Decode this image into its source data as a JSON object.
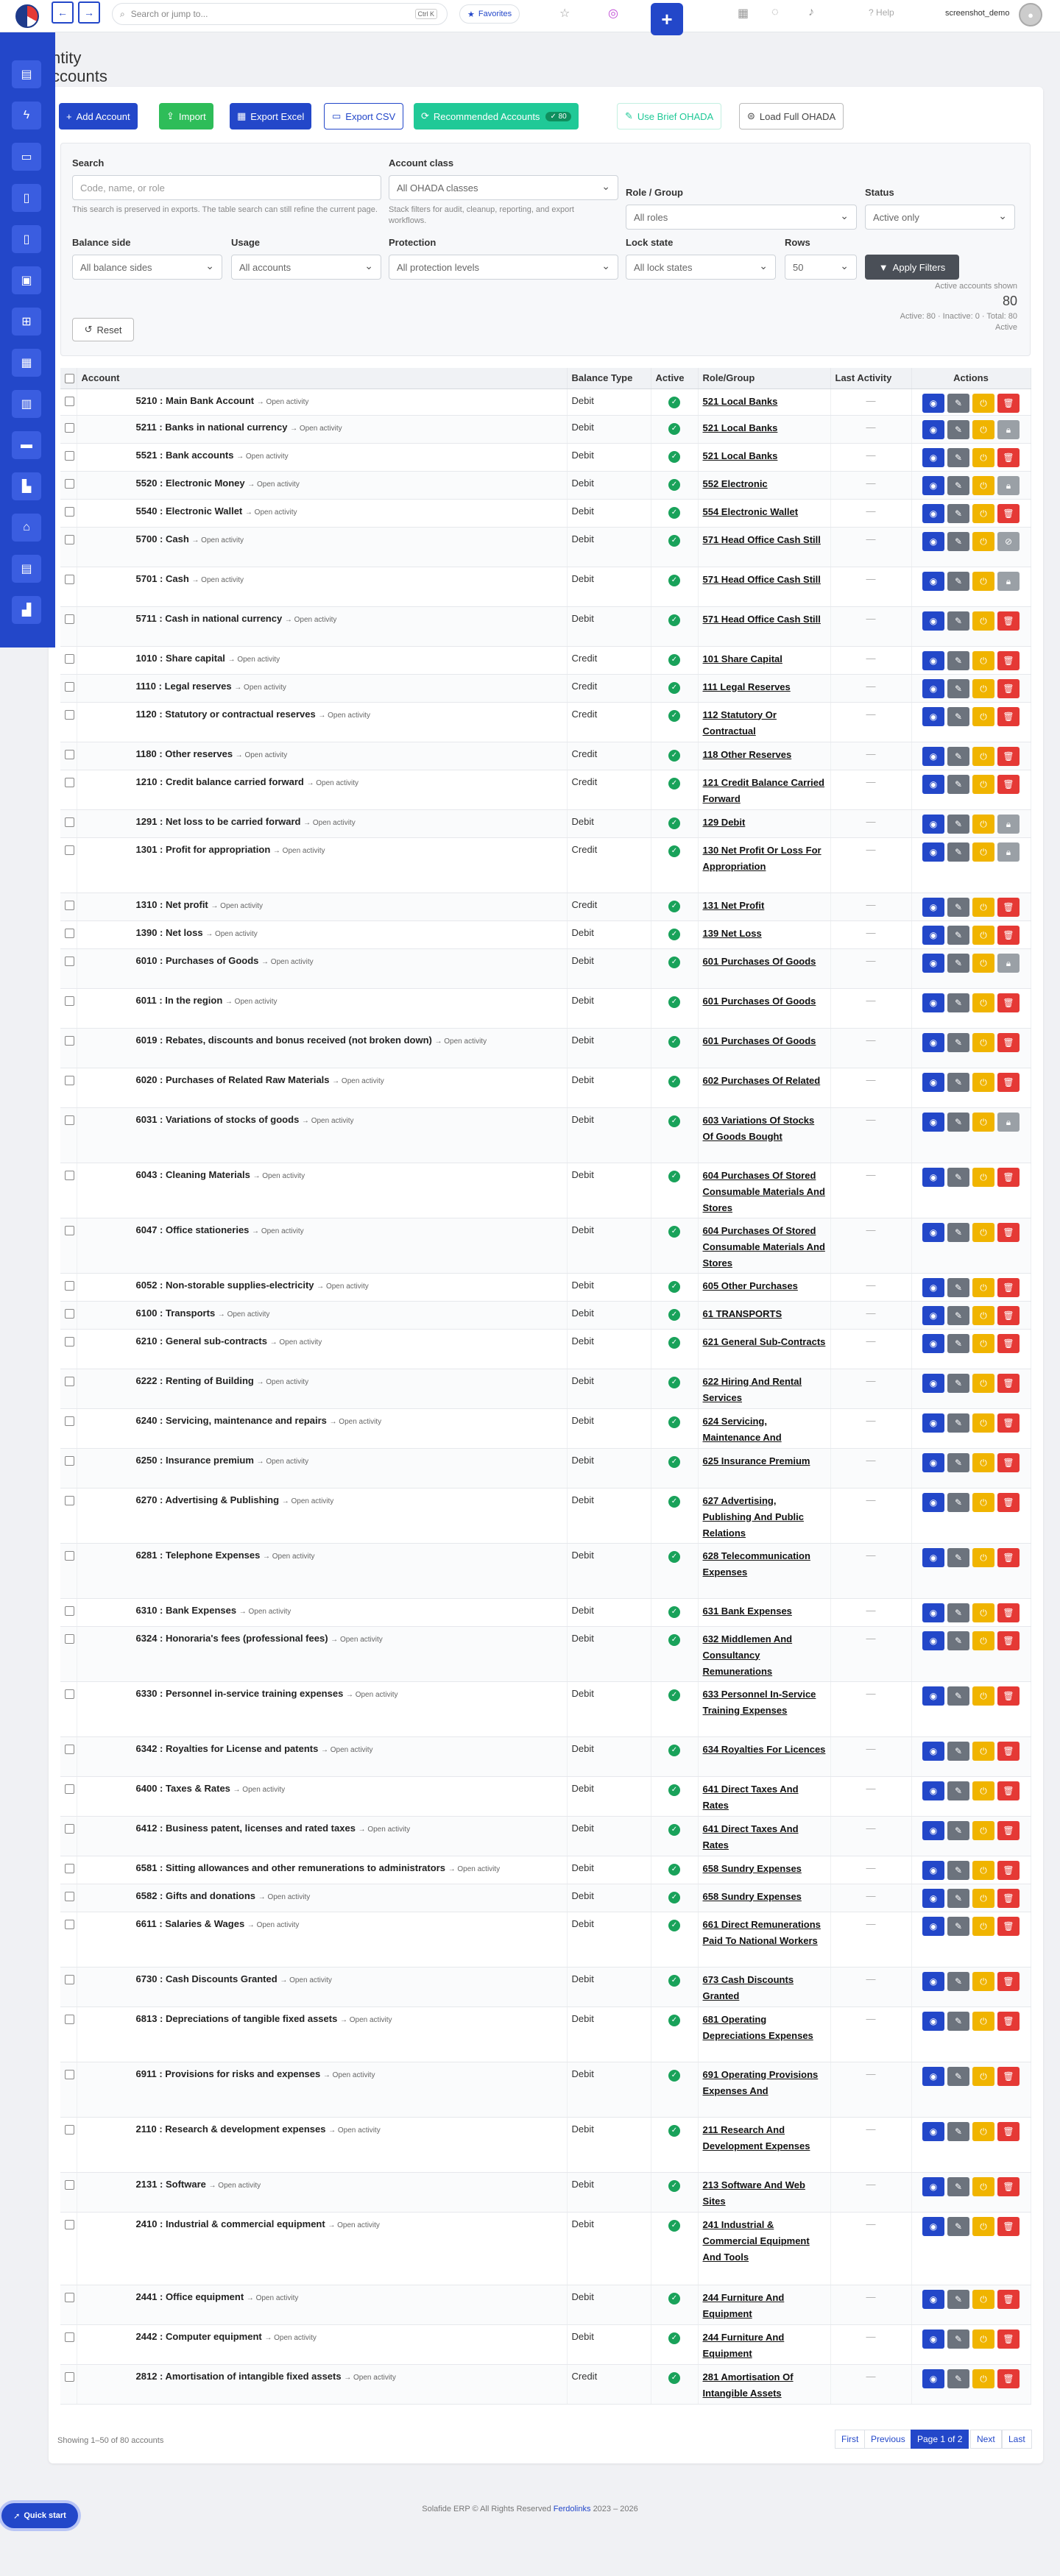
{
  "topbar": {
    "search_placeholder": "Search or jump to...",
    "search_kbd": "Ctrl K",
    "favorites": "Favorites",
    "help": "Help",
    "user": "screenshot_demo"
  },
  "page": {
    "title_line1": "ntity",
    "title_line2": "ccounts"
  },
  "toolbar": {
    "add": "Add Account",
    "import": "Import",
    "export_excel": "Export Excel",
    "export_csv": "Export CSV",
    "recommended": "Recommended Accounts",
    "recommended_count": "80",
    "brief_ohada": "Use Brief OHADA",
    "full_ohada": "Load Full OHADA"
  },
  "filters": {
    "search_label": "Search",
    "search_placeholder": "Code, name, or role",
    "search_hint": "This search is preserved in exports. The table search can still refine the current page.",
    "class_label": "Account class",
    "class_value": "All OHADA classes",
    "class_hint": "Stack filters for audit, cleanup, reporting, and export workflows.",
    "role_label": "Role / Group",
    "role_value": "All roles",
    "status_label": "Status",
    "status_value": "Active only",
    "balance_label": "Balance side",
    "balance_value": "All balance sides",
    "usage_label": "Usage",
    "usage_value": "All accounts",
    "protection_label": "Protection",
    "protection_value": "All protection levels",
    "lock_label": "Lock state",
    "lock_value": "All lock states",
    "rows_label": "Rows",
    "rows_value": "50",
    "apply": "Apply Filters",
    "reset": "Reset",
    "stats_label": "Active accounts shown",
    "stats_count": "80",
    "stats_detail": "Active: 80 · Inactive: 0 · Total: 80",
    "stats_active": "Active"
  },
  "table": {
    "headers": [
      "Account",
      "Balance Type",
      "Active",
      "Role/Group",
      "Last Activity",
      "Actions"
    ],
    "open_activity": "→ Open activity",
    "last_activity_empty": "—",
    "rows": [
      {
        "code": "5210",
        "name": "Main Bank Account",
        "balance": "Debit",
        "role": "521 Local Banks",
        "actions": "del"
      },
      {
        "code": "5211",
        "name": "Banks in national currency",
        "balance": "Debit",
        "role": "521 Local Banks",
        "actions": "lock"
      },
      {
        "code": "5521",
        "name": "Bank accounts",
        "balance": "Debit",
        "role": "521 Local Banks",
        "actions": "del"
      },
      {
        "code": "5520",
        "name": "Electronic Money",
        "balance": "Debit",
        "role": "552 Electronic",
        "actions": "lock"
      },
      {
        "code": "5540",
        "name": "Electronic Wallet",
        "balance": "Debit",
        "role": "554 Electronic Wallet",
        "actions": "del"
      },
      {
        "code": "5700",
        "name": "Cash",
        "balance": "Debit",
        "role": "571 Head Office Cash Still",
        "actions": "ban"
      },
      {
        "code": "5701",
        "name": "Cash",
        "balance": "Debit",
        "role": "571 Head Office Cash Still",
        "actions": "lock"
      },
      {
        "code": "5711",
        "name": "Cash in national currency",
        "balance": "Debit",
        "role": "571 Head Office Cash Still",
        "actions": "del"
      },
      {
        "code": "1010",
        "name": "Share capital",
        "balance": "Credit",
        "role": "101 Share Capital",
        "actions": "del"
      },
      {
        "code": "1110",
        "name": "Legal reserves",
        "balance": "Credit",
        "role": "111 Legal Reserves",
        "actions": "del"
      },
      {
        "code": "1120",
        "name": "Statutory or contractual reserves",
        "balance": "Credit",
        "role": "112 Statutory Or Contractual",
        "actions": "del"
      },
      {
        "code": "1180",
        "name": "Other reserves",
        "balance": "Credit",
        "role": "118 Other Reserves",
        "actions": "del"
      },
      {
        "code": "1210",
        "name": "Credit balance carried forward",
        "balance": "Credit",
        "role": "121 Credit Balance Carried Forward",
        "actions": "del"
      },
      {
        "code": "1291",
        "name": "Net loss to be carried forward",
        "balance": "Debit",
        "role": "129 Debit",
        "actions": "lock"
      },
      {
        "code": "1301",
        "name": "Profit for appropriation",
        "balance": "Credit",
        "role": "130 Net Profit Or Loss For Appropriation",
        "actions": "lock"
      },
      {
        "code": "1310",
        "name": "Net profit",
        "balance": "Credit",
        "role": "131 Net Profit",
        "actions": "del"
      },
      {
        "code": "1390",
        "name": "Net loss",
        "balance": "Debit",
        "role": "139 Net Loss",
        "actions": "del"
      },
      {
        "code": "6010",
        "name": "Purchases of Goods",
        "balance": "Debit",
        "role": "601 Purchases Of Goods",
        "actions": "lock"
      },
      {
        "code": "6011",
        "name": "In the region",
        "balance": "Debit",
        "role": "601 Purchases Of Goods",
        "actions": "del"
      },
      {
        "code": "6019",
        "name": "Rebates, discounts and bonus received (not broken down)",
        "balance": "Debit",
        "role": "601 Purchases Of Goods",
        "actions": "del"
      },
      {
        "code": "6020",
        "name": "Purchases of Related Raw Materials",
        "balance": "Debit",
        "role": "602 Purchases Of Related",
        "actions": "del"
      },
      {
        "code": "6031",
        "name": "Variations of stocks of goods",
        "balance": "Debit",
        "role": "603 Variations Of Stocks Of Goods Bought",
        "actions": "lock"
      },
      {
        "code": "6043",
        "name": "Cleaning Materials",
        "balance": "Debit",
        "role": "604 Purchases Of Stored Consumable Materials And Stores",
        "actions": "del"
      },
      {
        "code": "6047",
        "name": "Office stationeries",
        "balance": "Debit",
        "role": "604 Purchases Of Stored Consumable Materials And Stores",
        "actions": "del"
      },
      {
        "code": "6052",
        "name": "Non-storable supplies-electricity",
        "balance": "Debit",
        "role": "605 Other Purchases",
        "actions": "del"
      },
      {
        "code": "6100",
        "name": "Transports",
        "balance": "Debit",
        "role": "61 TRANSPORTS",
        "actions": "del"
      },
      {
        "code": "6210",
        "name": "General sub-contracts",
        "balance": "Debit",
        "role": "621 General Sub-Contracts",
        "actions": "del"
      },
      {
        "code": "6222",
        "name": "Renting of Building",
        "balance": "Debit",
        "role": "622 Hiring And Rental Services",
        "actions": "del"
      },
      {
        "code": "6240",
        "name": "Servicing, maintenance and repairs",
        "balance": "Debit",
        "role": "624 Servicing, Maintenance And",
        "actions": "del"
      },
      {
        "code": "6250",
        "name": "Insurance premium",
        "balance": "Debit",
        "role": "625 Insurance Premium",
        "actions": "del"
      },
      {
        "code": "6270",
        "name": "Advertising & Publishing",
        "balance": "Debit",
        "role": "627 Advertising, Publishing And Public Relations",
        "actions": "del"
      },
      {
        "code": "6281",
        "name": "Telephone Expenses",
        "balance": "Debit",
        "role": "628 Telecommunication Expenses",
        "actions": "del"
      },
      {
        "code": "6310",
        "name": "Bank Expenses",
        "balance": "Debit",
        "role": "631 Bank Expenses",
        "actions": "del"
      },
      {
        "code": "6324",
        "name": "Honoraria's fees (professional fees)",
        "balance": "Debit",
        "role": "632 Middlemen And Consultancy Remunerations",
        "actions": "del"
      },
      {
        "code": "6330",
        "name": "Personnel in-service training expenses",
        "balance": "Debit",
        "role": "633 Personnel In-Service Training Expenses",
        "actions": "del"
      },
      {
        "code": "6342",
        "name": "Royalties for License and patents",
        "balance": "Debit",
        "role": "634 Royalties For Licences",
        "actions": "del"
      },
      {
        "code": "6400",
        "name": "Taxes & Rates",
        "balance": "Debit",
        "role": "641 Direct Taxes And Rates",
        "actions": "del"
      },
      {
        "code": "6412",
        "name": "Business patent, licenses and rated taxes",
        "balance": "Debit",
        "role": "641 Direct Taxes And Rates",
        "actions": "del"
      },
      {
        "code": "6581",
        "name": "Sitting allowances and other remunerations to administrators",
        "balance": "Debit",
        "role": "658 Sundry Expenses",
        "actions": "del"
      },
      {
        "code": "6582",
        "name": "Gifts and donations",
        "balance": "Debit",
        "role": "658 Sundry Expenses",
        "actions": "del"
      },
      {
        "code": "6611",
        "name": "Salaries & Wages",
        "balance": "Debit",
        "role": "661 Direct Remunerations Paid To National Workers",
        "actions": "del"
      },
      {
        "code": "6730",
        "name": "Cash Discounts Granted",
        "balance": "Debit",
        "role": "673 Cash Discounts Granted",
        "actions": "del"
      },
      {
        "code": "6813",
        "name": "Depreciations of tangible fixed assets",
        "balance": "Debit",
        "role": "681 Operating Depreciations Expenses",
        "actions": "del"
      },
      {
        "code": "6911",
        "name": "Provisions for risks and expenses",
        "balance": "Debit",
        "role": "691 Operating Provisions Expenses And",
        "actions": "del"
      },
      {
        "code": "2110",
        "name": "Research & development expenses",
        "balance": "Debit",
        "role": "211 Research And Development Expenses",
        "actions": "del"
      },
      {
        "code": "2131",
        "name": "Software",
        "balance": "Debit",
        "role": "213 Software And Web Sites",
        "actions": "del"
      },
      {
        "code": "2410",
        "name": "Industrial & commercial equipment",
        "balance": "Debit",
        "role": "241 Industrial & Commercial Equipment And Tools",
        "actions": "del"
      },
      {
        "code": "2441",
        "name": "Office equipment",
        "balance": "Debit",
        "role": "244 Furniture And Equipment",
        "actions": "del"
      },
      {
        "code": "2442",
        "name": "Computer equipment",
        "balance": "Debit",
        "role": "244 Furniture And Equipment",
        "actions": "del"
      },
      {
        "code": "2812",
        "name": "Amortisation of intangible fixed assets",
        "balance": "Credit",
        "role": "281 Amortisation Of Intangible Assets",
        "actions": "del"
      }
    ]
  },
  "pagination": {
    "info": "Showing 1–50 of 80 accounts",
    "first": "First",
    "previous": "Previous",
    "current": "Page 1 of 2",
    "next": "Next",
    "last": "Last"
  },
  "footer": {
    "text": "Solafide ERP © All Rights Reserved",
    "brand": "Ferdolinks",
    "years": "2023 – 2026"
  },
  "quick_start": "Quick start",
  "icons": {
    "colors": {
      "primary": "#2347c9",
      "success": "#19a25a",
      "warning": "#f0b400",
      "danger": "#e53935"
    }
  }
}
